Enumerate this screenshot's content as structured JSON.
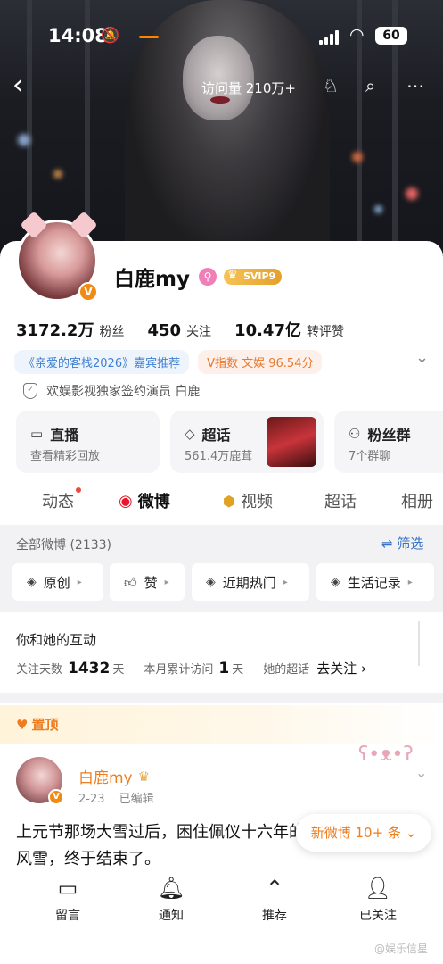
{
  "status_bar": {
    "time": "14:08",
    "battery": "60"
  },
  "nav": {
    "visits": "访问量 210万+"
  },
  "profile": {
    "name": "白鹿my",
    "vip_badge": "SVIP9",
    "stats": [
      {
        "value": "3172.2万",
        "label": "粉丝"
      },
      {
        "value": "450",
        "label": "关注"
      },
      {
        "value": "10.47亿",
        "label": "转评赞"
      }
    ],
    "tags": [
      "《亲爱的客栈2026》嘉宾推荐",
      "V指数 文娱 96.54分"
    ],
    "signature": "欢娱影视独家签约演员 白鹿"
  },
  "tiles": [
    {
      "title": "直播",
      "sub": "查看精彩回放",
      "icon": "tv-icon"
    },
    {
      "title": "超话",
      "sub": "561.4万鹿茸",
      "icon": "diamond-icon"
    },
    {
      "title": "粉丝群",
      "sub": "7个群聊",
      "icon": "group-icon"
    }
  ],
  "tabs": [
    "动态",
    "微博",
    "视频",
    "超话",
    "相册"
  ],
  "feed": {
    "all_label": "全部微博 (2133)",
    "filter_label": "筛选",
    "chips": [
      "原创",
      "赞",
      "近期热门",
      "生活记录"
    ]
  },
  "interaction": {
    "heading": "你和她的互动",
    "follow_days_label": "关注天数",
    "follow_days_value": "1432",
    "follow_days_unit": "天",
    "visits_label": "本月累计访问",
    "visits_value": "1",
    "visits_unit": "天",
    "chaohua_label": "她的超话",
    "chaohua_action": "去关注"
  },
  "pinned_post": {
    "pinned_label": "置顶",
    "author": "白鹿my",
    "date": "2-23",
    "edited": "已编辑",
    "text": "上元节那场大雪过后，困住佩仪十六年的风雪，终于结束了。",
    "new_posts": "新微博 10+ 条"
  },
  "bottom_bar": [
    {
      "label": "留言",
      "icon": "comment-icon"
    },
    {
      "label": "通知",
      "icon": "bell-plus-icon"
    },
    {
      "label": "推荐",
      "icon": "up-circle-icon"
    },
    {
      "label": "已关注",
      "icon": "user-check-icon"
    }
  ],
  "watermark": "@娱乐信星",
  "colors": {
    "accent_orange": "#ff8200",
    "link_blue": "#3a73c5",
    "name_orange": "#ee7d1f"
  }
}
